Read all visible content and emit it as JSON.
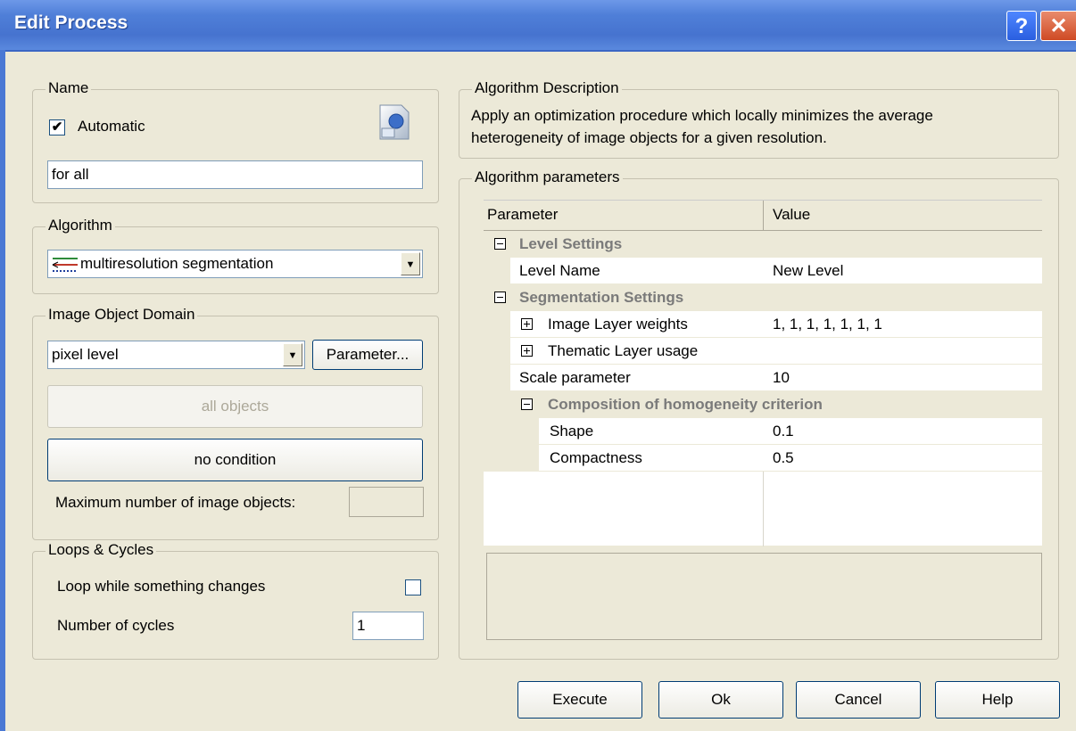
{
  "window": {
    "title": "Edit Process",
    "help_glyph": "?",
    "close_glyph": "✕"
  },
  "name_group": {
    "legend": "Name",
    "automatic_label": "Automatic",
    "automatic_checked": true,
    "name_value": "for all"
  },
  "algorithm_group": {
    "legend": "Algorithm",
    "selected": "multiresolution segmentation"
  },
  "domain_group": {
    "legend": "Image Object Domain",
    "domain_value": "pixel level",
    "parameter_button": "Parameter...",
    "all_objects_button": "all objects",
    "condition_button": "no condition",
    "max_objects_label": "Maximum number of image objects:",
    "max_objects_value": ""
  },
  "loops_group": {
    "legend": "Loops & Cycles",
    "loop_label": "Loop while something changes",
    "loop_checked": false,
    "cycles_label": "Number of cycles",
    "cycles_value": "1"
  },
  "description_group": {
    "legend": "Algorithm Description",
    "text_line1": "Apply an optimization procedure which locally minimizes the average",
    "text_line2": "heterogeneity of image objects for a given resolution."
  },
  "params_group": {
    "legend": "Algorithm parameters",
    "col_parameter": "Parameter",
    "col_value": "Value",
    "level_settings": "Level Settings",
    "level_name_label": "Level Name",
    "level_name_value": "New Level",
    "segmentation_settings": "Segmentation Settings",
    "image_layer_weights_label": "Image Layer weights",
    "image_layer_weights_value": "1, 1, 1, 1, 1, 1, 1",
    "thematic_layer_usage_label": "Thematic Layer usage",
    "thematic_layer_usage_value": "",
    "scale_parameter_label": "Scale parameter",
    "scale_parameter_value": "10",
    "composition_label": "Composition of homogeneity criterion",
    "shape_label": "Shape",
    "shape_value": "0.1",
    "compactness_label": "Compactness",
    "compactness_value": "0.5"
  },
  "buttons": {
    "execute": "Execute",
    "ok": "Ok",
    "cancel": "Cancel",
    "help": "Help"
  }
}
